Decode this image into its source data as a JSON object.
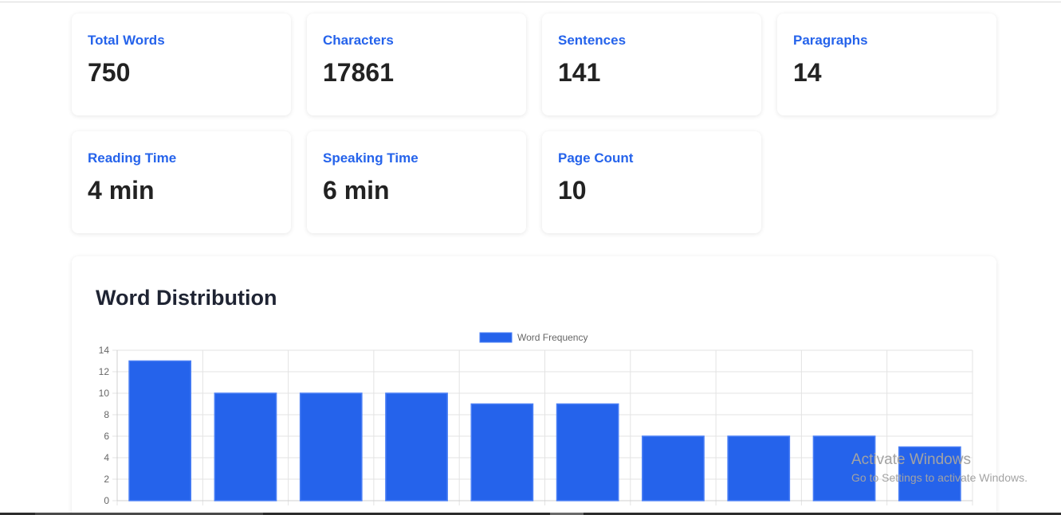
{
  "stats": {
    "total_words": {
      "label": "Total Words",
      "value": "750"
    },
    "characters": {
      "label": "Characters",
      "value": "17861"
    },
    "sentences": {
      "label": "Sentences",
      "value": "141"
    },
    "paragraphs": {
      "label": "Paragraphs",
      "value": "14"
    },
    "reading_time": {
      "label": "Reading Time",
      "value": "4 min"
    },
    "speaking_time": {
      "label": "Speaking Time",
      "value": "6 min"
    },
    "page_count": {
      "label": "Page Count",
      "value": "10"
    }
  },
  "chart_section": {
    "title": "Word Distribution"
  },
  "chart_data": {
    "type": "bar",
    "categories": [
      "",
      "",
      "",
      "",
      "",
      "",
      "",
      "",
      "",
      ""
    ],
    "series": [
      {
        "name": "Word Frequency",
        "values": [
          13,
          10,
          10,
          10,
          9,
          9,
          6,
          6,
          6,
          5
        ]
      }
    ],
    "ylim": [
      0,
      14
    ],
    "y_ticks": [
      "0",
      "2",
      "4",
      "6",
      "8",
      "10",
      "12",
      "14"
    ],
    "grid": true,
    "legend_position": "top-center",
    "colors": {
      "bar_fill": "#2563eb",
      "bar_border": "#4a7ff5"
    }
  },
  "watermark": {
    "line1": "Activate Windows",
    "line2": "Go to Settings to activate Windows."
  },
  "colors": {
    "accent": "#2563eb",
    "value_text": "#222222",
    "heading_text": "#1f2433"
  }
}
